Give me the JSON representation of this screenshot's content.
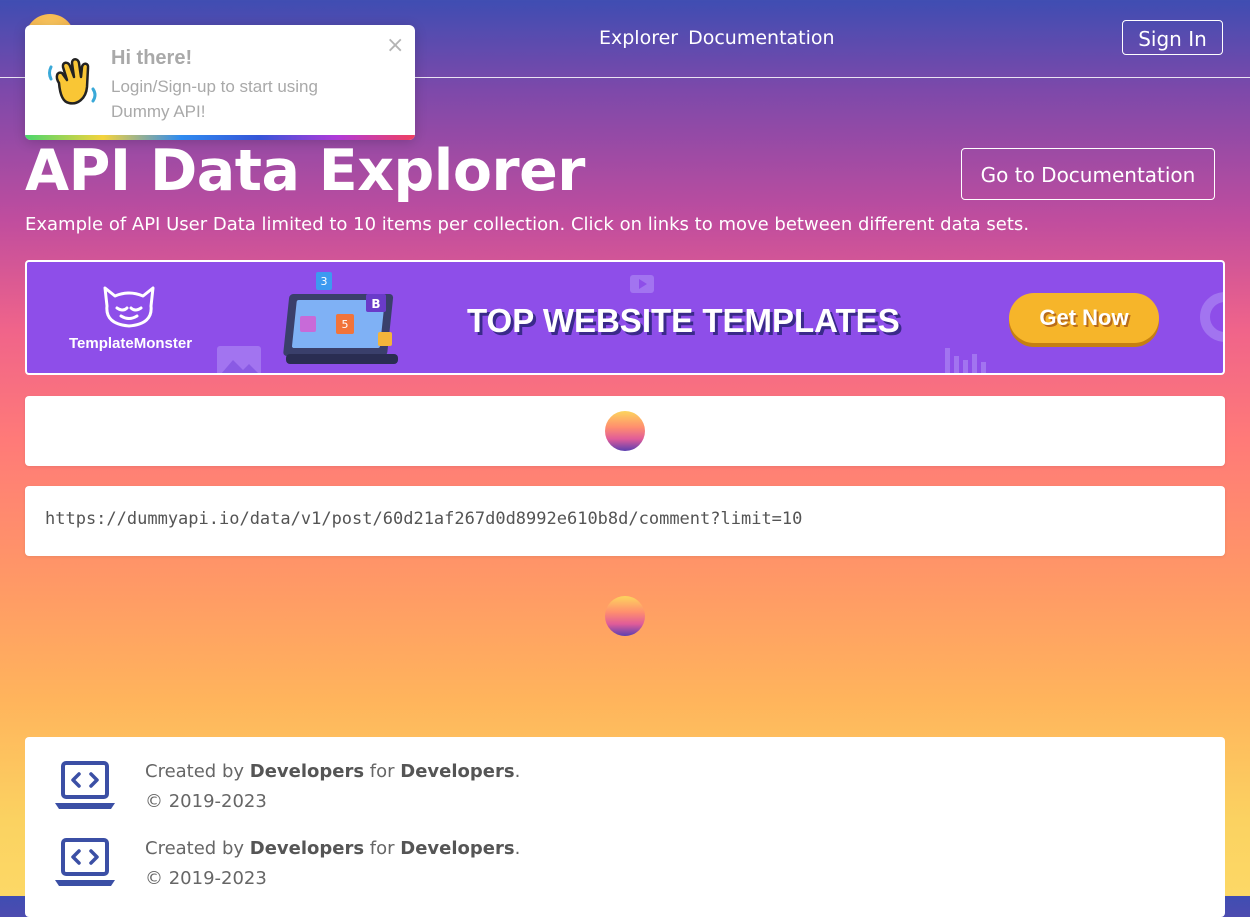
{
  "header": {
    "nav": [
      "Explorer",
      "Documentation"
    ],
    "sign_in": "Sign In"
  },
  "toast": {
    "title": "Hi there!",
    "message": "Login/Sign-up to start using Dummy API!",
    "close": "×"
  },
  "hero": {
    "title": "API Data Explorer",
    "button": "Go to Documentation",
    "subtitle": "Example of API User Data limited to 10 items per collection. Click on links to move between different data sets."
  },
  "banner": {
    "brand": "TemplateMonster",
    "headline": "TOP WEBSITE TEMPLATES",
    "cta": "Get Now"
  },
  "request": {
    "url": "https://dummyapi.io/data/v1/post/60d21af267d0d8992e610b8d/comment?limit=10"
  },
  "footer": {
    "rows": [
      {
        "prefix": "Created by ",
        "who": "Developers",
        "mid": " for ",
        "whom": "Developers",
        "end": ".",
        "copyright": "© 2019-2023"
      },
      {
        "prefix": "Created by ",
        "who": "Developers",
        "mid": " for ",
        "whom": "Developers",
        "end": ".",
        "copyright": "© 2019-2023"
      }
    ]
  },
  "colors": {
    "accent": "#3f4db2",
    "banner_bg": "#8e4ee9",
    "cta": "#f6b52a"
  }
}
